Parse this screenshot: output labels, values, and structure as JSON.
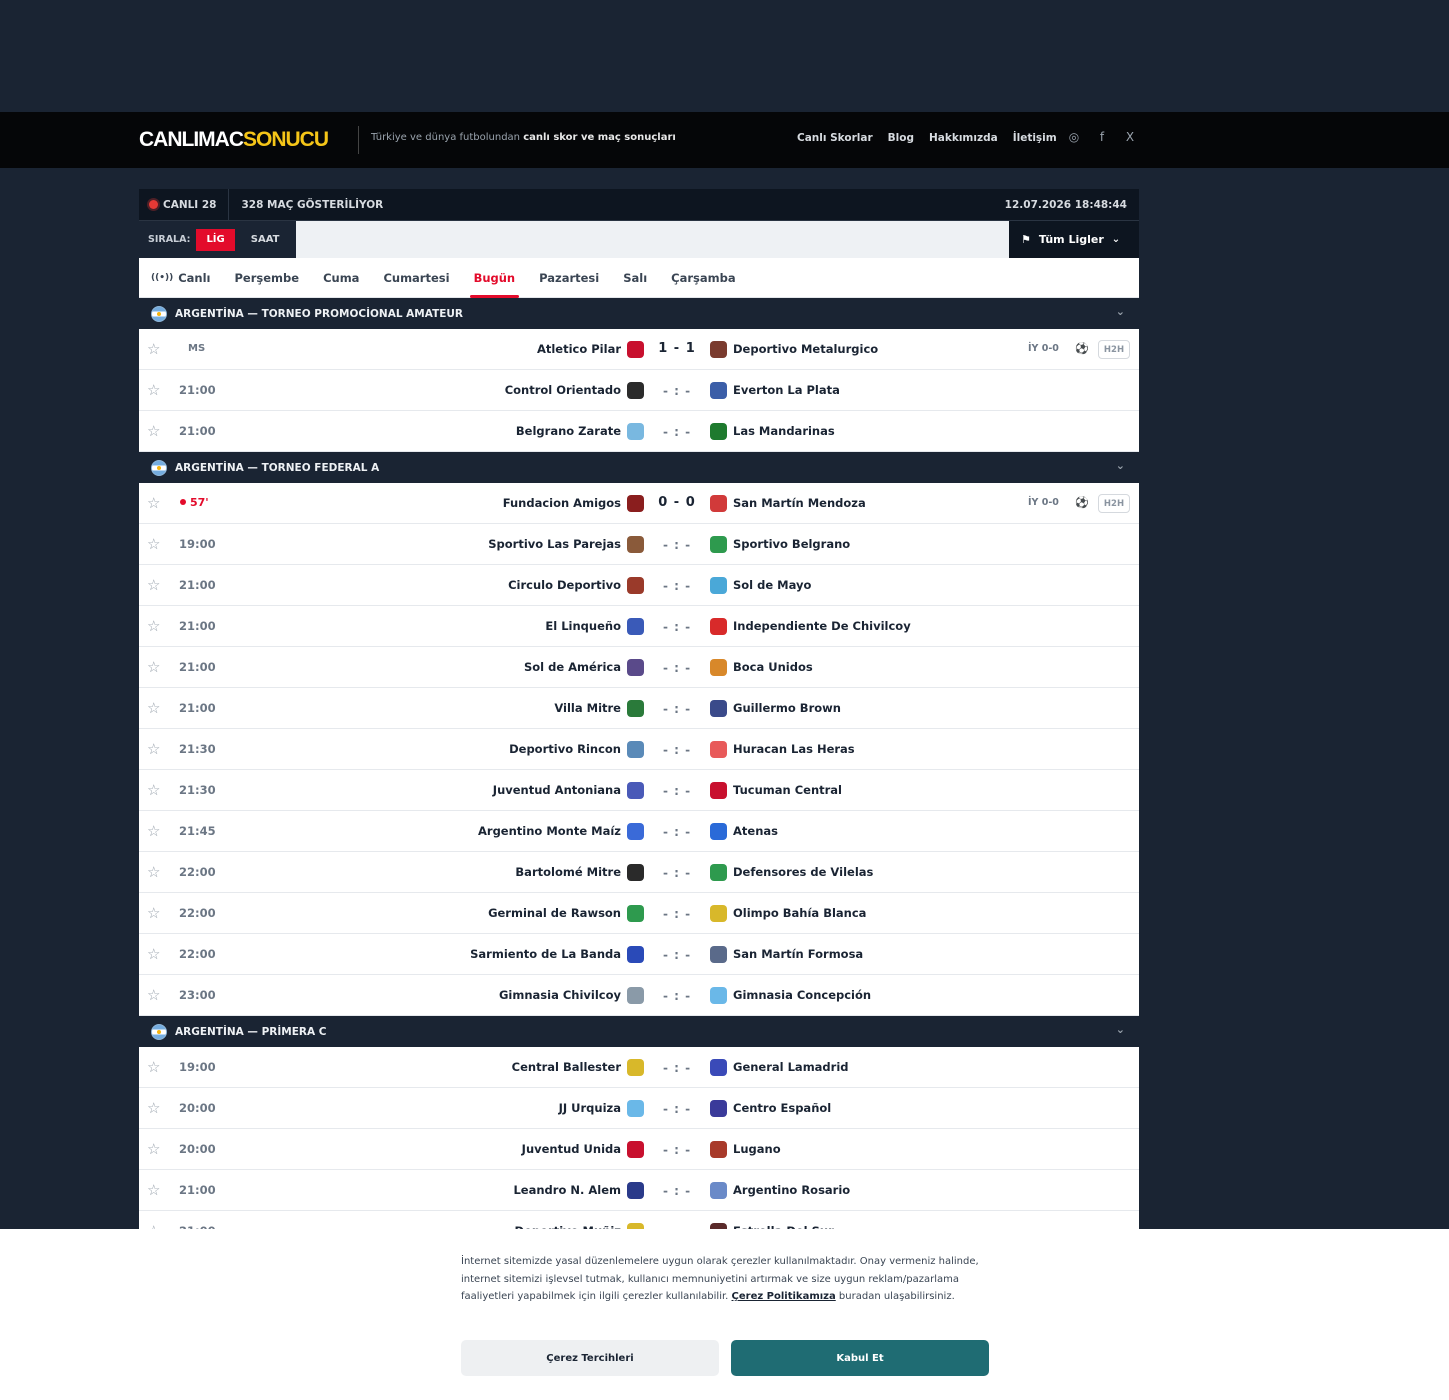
{
  "header": {
    "logo_a": "CANLIMAC",
    "logo_b": "SONUCU",
    "tagline_pre": "Türkiye ve dünya futbolundan ",
    "tagline_bold": "canlı skor ve maç sonuçları",
    "nav": [
      "Canlı Skorlar",
      "Blog",
      "Hakkımızda",
      "İletişim"
    ],
    "social": [
      "◎",
      "f",
      "X"
    ]
  },
  "topbar": {
    "live_label": "CANLI 28",
    "count_label": "328 MAÇ GÖSTERİLİYOR",
    "datetime": "12.07.2026 18:48:44"
  },
  "sort": {
    "label": "SIRALA:",
    "lig": "LİG",
    "saat": "SAAT",
    "leagues_btn": "Tüm Ligler"
  },
  "days": [
    "Canlı",
    "Perşembe",
    "Cuma",
    "Cumartesi",
    "Bugün",
    "Pazartesi",
    "Salı",
    "Çarşamba"
  ],
  "leagues": [
    {
      "title": "ARGENTİNA — TORNEO PROMOCİONAL AMATEUR",
      "matches": [
        {
          "time": "MS",
          "home": "Atletico Pilar",
          "away": "Deportivo Metalurgico",
          "score": "1 - 1",
          "iy": "İY 0-0",
          "h2h": "H2H",
          "hc": "#c8102e",
          "ac": "#7a3b2e"
        },
        {
          "time": "21:00",
          "home": "Control Orientado",
          "away": "Everton La Plata",
          "score": "- : -",
          "hc": "#2b2b2b",
          "ac": "#3b5ea8"
        },
        {
          "time": "21:00",
          "home": "Belgrano Zarate",
          "away": "Las Mandarinas",
          "score": "- : -",
          "hc": "#79b8e0",
          "ac": "#1e7a2e"
        }
      ]
    },
    {
      "title": "ARGENTİNA — TORNEO FEDERAL A",
      "matches": [
        {
          "time": "57'",
          "home": "Fundacion Amigos",
          "away": "San Martín Mendoza",
          "score": "0 - 0",
          "iy": "İY 0-0",
          "h2h": "H2H",
          "hc": "#8a1e1e",
          "ac": "#d13a3a"
        },
        {
          "time": "19:00",
          "home": "Sportivo Las Parejas",
          "away": "Sportivo Belgrano",
          "score": "- : -",
          "hc": "#8a5a3a",
          "ac": "#2e9a4e"
        },
        {
          "time": "21:00",
          "home": "Circulo Deportivo",
          "away": "Sol de Mayo",
          "score": "- : -",
          "hc": "#9a3a2a",
          "ac": "#4aa8d8"
        },
        {
          "time": "21:00",
          "home": "El Linqueño",
          "away": "Independiente De Chivilcoy",
          "score": "- : -",
          "hc": "#3a5ab8",
          "ac": "#d82a2a"
        },
        {
          "time": "21:00",
          "home": "Sol de América",
          "away": "Boca Unidos",
          "score": "- : -",
          "hc": "#5a4a8a",
          "ac": "#d8882a"
        },
        {
          "time": "21:00",
          "home": "Villa Mitre",
          "away": "Guillermo Brown",
          "score": "- : -",
          "hc": "#2a7a3a",
          "ac": "#3a4a8a"
        },
        {
          "time": "21:30",
          "home": "Deportivo Rincon",
          "away": "Huracan Las Heras",
          "score": "- : -",
          "hc": "#5a8ab8",
          "ac": "#e85a5a"
        },
        {
          "time": "21:30",
          "home": "Juventud Antoniana",
          "away": "Tucuman Central",
          "score": "- : -",
          "hc": "#4a5ab8",
          "ac": "#c8102e"
        },
        {
          "time": "21:45",
          "home": "Argentino Monte Maíz",
          "away": "Atenas",
          "score": "- : -",
          "hc": "#3a6ad8",
          "ac": "#2a6ad8"
        },
        {
          "time": "22:00",
          "home": "Bartolomé Mitre",
          "away": "Defensores de Vilelas",
          "score": "- : -",
          "hc": "#2a2a2a",
          "ac": "#2e9a4e"
        },
        {
          "time": "22:00",
          "home": "Germinal de Rawson",
          "away": "Olimpo Bahía Blanca",
          "score": "- : -",
          "hc": "#2e9a4e",
          "ac": "#d8b82a"
        },
        {
          "time": "22:00",
          "home": "Sarmiento de La Banda",
          "away": "San Martín Formosa",
          "score": "- : -",
          "hc": "#2a4ab8",
          "ac": "#5a6a8a"
        },
        {
          "time": "23:00",
          "home": "Gimnasia Chivilcoy",
          "away": "Gimnasia Concepción",
          "score": "- : -",
          "hc": "#8a9aa8",
          "ac": "#6ab8e8"
        }
      ]
    },
    {
      "title": "ARGENTİNA — PRİMERA C",
      "matches": [
        {
          "time": "19:00",
          "home": "Central Ballester",
          "away": "General Lamadrid",
          "score": "- : -",
          "hc": "#d8b82a",
          "ac": "#3a4ab8"
        },
        {
          "time": "20:00",
          "home": "JJ Urquiza",
          "away": "Centro Español",
          "score": "- : -",
          "hc": "#6ab8e8",
          "ac": "#3a3a9a"
        },
        {
          "time": "20:00",
          "home": "Juventud Unida",
          "away": "Lugano",
          "score": "- : -",
          "hc": "#c8102e",
          "ac": "#a83a2a"
        },
        {
          "time": "21:00",
          "home": "Leandro N. Alem",
          "away": "Argentino Rosario",
          "score": "- : -",
          "hc": "#2a3a8a",
          "ac": "#6a8ac8"
        },
        {
          "time": "21:00",
          "home": "Deportivo Muñiz",
          "away": "Estrella Del Sur",
          "score": "- : -",
          "hc": "#d8b82a",
          "ac": "#5a2a2a"
        }
      ]
    }
  ],
  "cookie": {
    "text_pre": "İnternet sitemizde yasal düzenlemelere uygun olarak çerezler kullanılmaktadır. Onay vermeniz halinde, internet sitemizi işlevsel tutmak, kullanıcı memnuniyetini artırmak ve size uygun reklam/pazarlama faaliyetleri yapabilmek için ilgili çerezler kullanılabilir. ",
    "link": "Çerez Politikamıza",
    "text_post": " buradan ulaşabilirsiniz.",
    "btn_prefs": "Çerez Tercihleri",
    "btn_accept": "Kabul Et"
  }
}
